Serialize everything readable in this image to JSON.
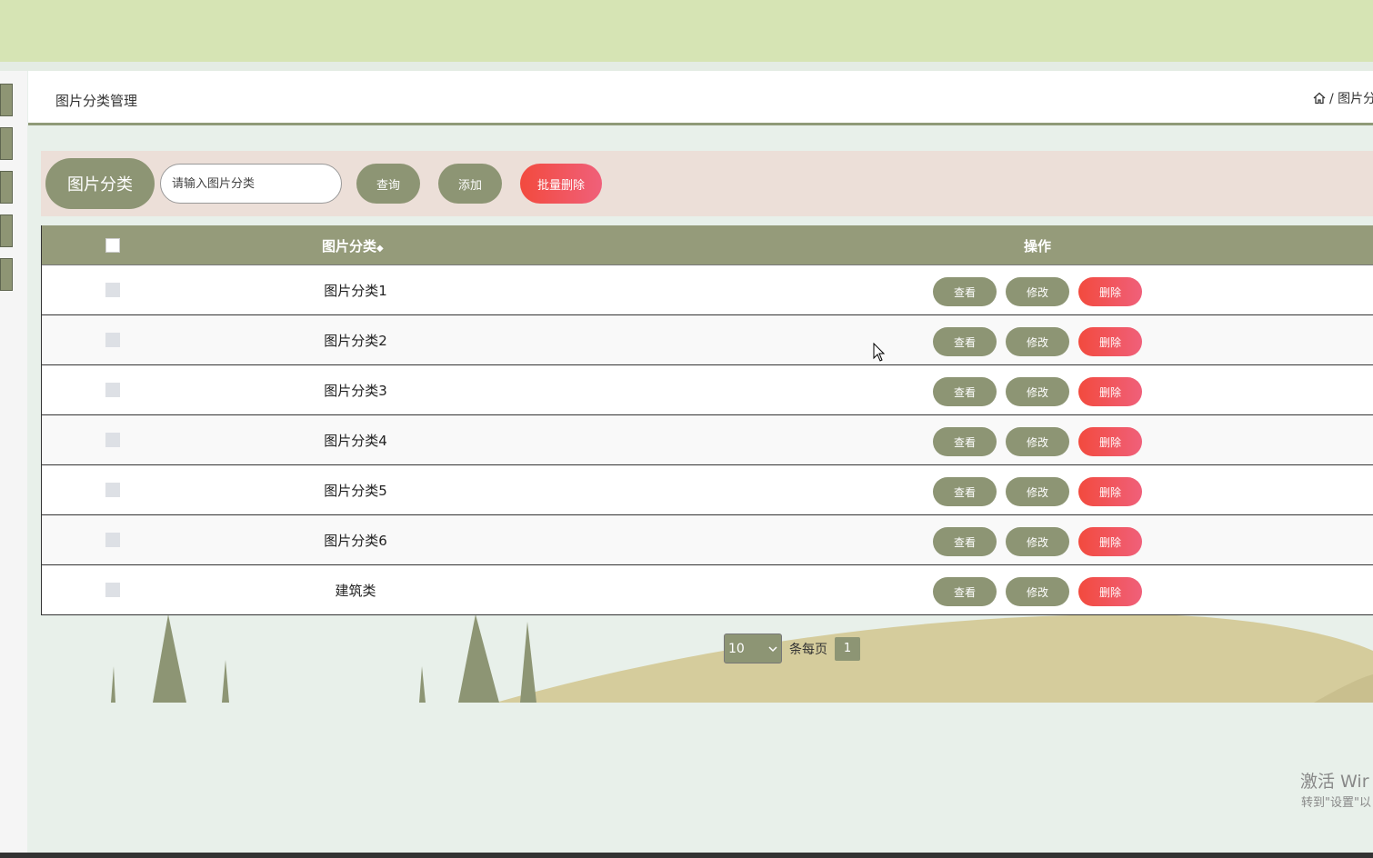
{
  "header": {
    "page_title": "图片分类管理",
    "breadcrumb": "/ 图片分",
    "home_icon": "home-icon"
  },
  "filter": {
    "label": "图片分类",
    "search_placeholder": "请输入图片分类",
    "query_button": "查询",
    "add_button": "添加",
    "batch_delete_button": "批量删除"
  },
  "table": {
    "col_name": "图片分类",
    "col_name_sort": "◆",
    "col_actions": "操作",
    "rows": [
      {
        "name": "图片分类1"
      },
      {
        "name": "图片分类2"
      },
      {
        "name": "图片分类3"
      },
      {
        "name": "图片分类4"
      },
      {
        "name": "图片分类5"
      },
      {
        "name": "图片分类6"
      },
      {
        "name": "建筑类"
      }
    ],
    "view_label": "查看",
    "edit_label": "修改",
    "delete_label": "删除"
  },
  "pagination": {
    "page_size": "10",
    "per_page_label": "条每页",
    "current_page": "1"
  },
  "watermark": {
    "line1": "激活 Wir",
    "line2": "转到\"设置\"以"
  },
  "colors": {
    "accent": "#8d9574",
    "danger": "#f24a3e",
    "topbar": "#d6e4b4"
  }
}
